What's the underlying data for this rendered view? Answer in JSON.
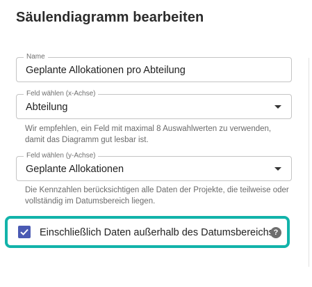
{
  "dialog": {
    "title": "Säulendiagramm bearbeiten"
  },
  "fields": {
    "name": {
      "label": "Name",
      "value": "Geplante Allokationen pro Abteilung"
    },
    "x_axis": {
      "label": "Feld wählen (x-Achse)",
      "value": "Abteilung",
      "helper": "Wir empfehlen, ein Feld mit maximal 8 Auswahlwerten zu verwenden, damit das Diagramm gut lesbar ist."
    },
    "y_axis": {
      "label": "Feld wählen (y-Achse)",
      "value": "Geplante Allokationen",
      "helper": "Die Kennzahlen berücksichtigen alle Daten der Projekte, die teilweise oder vollständig im Datumsbereich liegen."
    }
  },
  "include_outside": {
    "checked": true,
    "label": "Einschließlich Daten außerhalb des Datumsbereichs",
    "help_glyph": "?"
  },
  "colors": {
    "checkbox": "#4a5ab3",
    "highlight": "#12b3aa"
  },
  "icons": {
    "dropdown": "caret-down-icon",
    "help": "help-circle-icon",
    "check": "checkmark-icon"
  }
}
